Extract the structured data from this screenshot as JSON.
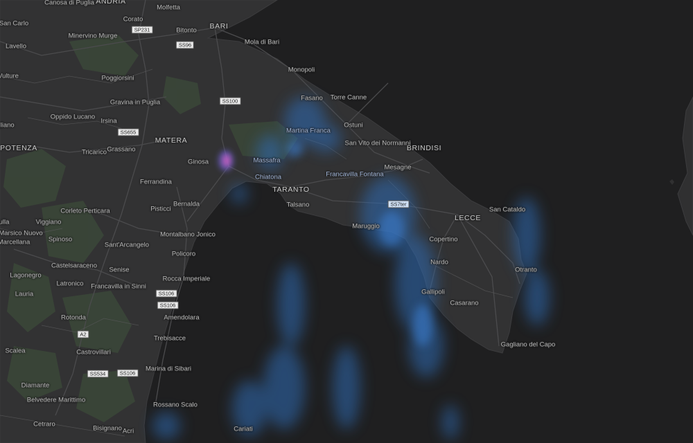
{
  "map": {
    "cities": {
      "major": [
        "BARI",
        "MATERA",
        "POTENZA",
        "TARANTO",
        "BRINDISI",
        "LECCE",
        "ANDRIA"
      ],
      "towns": [
        "Canosa di Puglia",
        "Corato",
        "Molfetta",
        "Bitonto",
        "Mola di Bari",
        "San Carlo",
        "Lavello",
        "Minervino Murge",
        "Monopoli",
        "Vulture",
        "Poggiorsini",
        "Gravina in Puglia",
        "Fasano",
        "Torre Canne",
        "Oppido Lucano",
        "Irsina",
        "Ostuni",
        "Martina Franca",
        "San Vito dei Normanni",
        "Tricarico",
        "Grassano",
        "Ginosa",
        "Massafra",
        "Mesagne",
        "Chiatona",
        "Francavilla Fontana",
        "Ferrandina",
        "Talsano",
        "Bernalda",
        "Pisticci",
        "San Cataldo",
        "Corleto Perticara",
        "Viggiano",
        "Marsico Nuovo",
        "Marcellana",
        "Montalbano Jonico",
        "Maruggio",
        "Copertino",
        "Spinoso",
        "Sant'Arcangelo",
        "Policoro",
        "Nardo",
        "Castelsaraceno",
        "Senise",
        "Otranto",
        "Lagonegro",
        "Latronico",
        "Francavilla in Sinni",
        "Rocca Imperiale",
        "Gallipoli",
        "Casarano",
        "Lauria",
        "Rotonda",
        "Amendolara",
        "Trebisacce",
        "Gagliano del Capo",
        "Scalea",
        "Castrovillari",
        "Marina di Sibari",
        "Diamante",
        "Belvedere Marittimo",
        "Rossano Scalo",
        "Cetraro",
        "Bisignano",
        "Acri",
        "Cariati",
        "gliano",
        "ulla"
      ]
    },
    "road_shields": [
      "SP231",
      "SS96",
      "SS100",
      "SS655",
      "SS7ter",
      "SS106",
      "SS106",
      "A2",
      "SS534",
      "SS106"
    ],
    "colors": {
      "sea": "#1f1f20",
      "land": "#323233",
      "forest": "#3b4a3a",
      "roads": "#4a4a4c",
      "precip_light": "#2f6fb8",
      "precip_heavy": "#c65fbf"
    }
  }
}
